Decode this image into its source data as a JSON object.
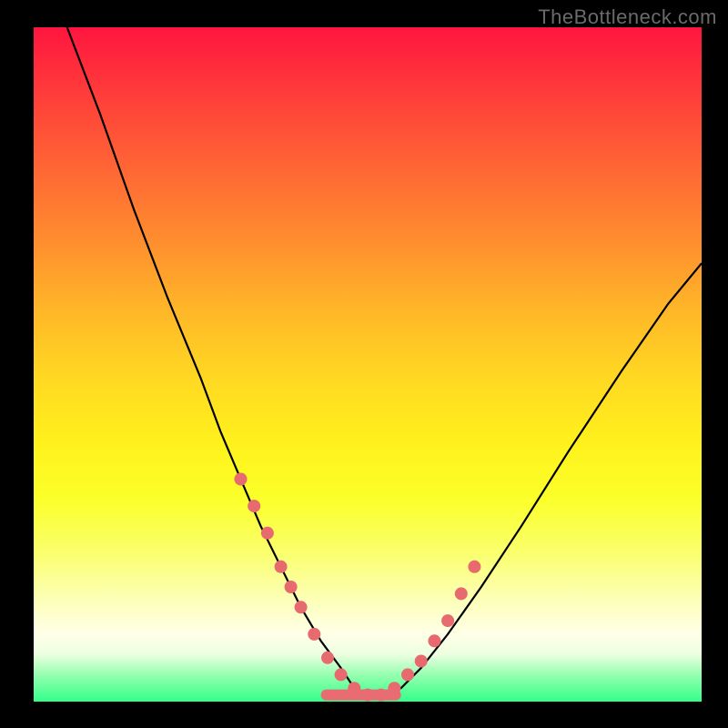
{
  "watermark": "TheBottleneck.com",
  "chart_data": {
    "type": "line",
    "title": "",
    "xlabel": "",
    "ylabel": "",
    "xlim": [
      0,
      100
    ],
    "ylim": [
      0,
      100
    ],
    "series": [
      {
        "name": "bottleneck-curve",
        "x": [
          5,
          10,
          15,
          20,
          25,
          28,
          31,
          34,
          37,
          40,
          43,
          46,
          48,
          50,
          52,
          55,
          58,
          62,
          67,
          73,
          80,
          88,
          95,
          100
        ],
        "values": [
          100,
          87,
          73,
          60,
          48,
          40,
          33,
          26,
          20,
          14,
          9,
          5,
          2,
          1,
          1,
          2,
          5,
          10,
          17,
          26,
          37,
          49,
          59,
          65
        ]
      }
    ],
    "markers": {
      "name": "highlight-dots",
      "color": "#e76a6f",
      "x": [
        31,
        33,
        35,
        37,
        38.5,
        40,
        42,
        44,
        46,
        48,
        50,
        52,
        54,
        56,
        58,
        60,
        62,
        64,
        66
      ],
      "values": [
        33,
        29,
        25,
        20,
        17,
        14,
        10,
        6.5,
        4,
        2,
        1,
        1,
        2,
        4,
        6,
        9,
        12,
        16,
        20
      ]
    },
    "green_band": {
      "name": "optimal-zone",
      "color": "#e86c71",
      "x_start": 43,
      "x_end": 55,
      "y": 1
    }
  }
}
